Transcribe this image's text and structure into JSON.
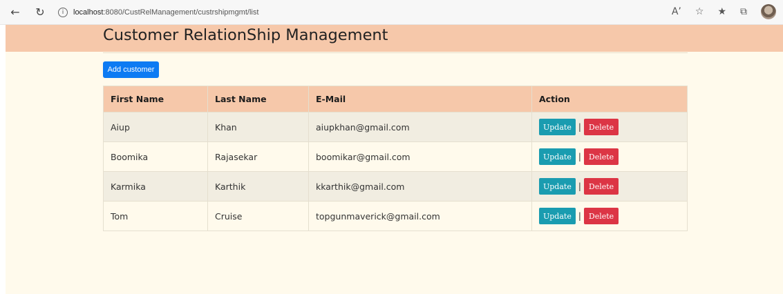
{
  "browser": {
    "back_icon": "arrow-left-icon",
    "reload_icon": "reload-icon",
    "info_icon": "info-icon",
    "url_host": "localhost",
    "url_rest": ":8080/CustRelManagement/custrshipmgmt/list",
    "right_icons": [
      "read-aloud-icon",
      "add-favorite-icon",
      "favorites-icon",
      "collections-icon",
      "profile-avatar"
    ]
  },
  "page": {
    "title": "Customer RelationShip Management",
    "add_button": "Add customer"
  },
  "table": {
    "headers": [
      "First Name",
      "Last Name",
      "E-Mail",
      "Action"
    ],
    "rows": [
      {
        "first": "Aiup",
        "last": "Khan",
        "email": "aiupkhan@gmail.com"
      },
      {
        "first": "Boomika",
        "last": "Rajasekar",
        "email": "boomikar@gmail.com"
      },
      {
        "first": "Karmika",
        "last": "Karthik",
        "email": "kkarthik@gmail.com"
      },
      {
        "first": "Tom",
        "last": "Cruise",
        "email": "topgunmaverick@gmail.com"
      }
    ],
    "update_label": "Update",
    "delete_label": "Delete",
    "separator": "|"
  },
  "colors": {
    "header_band": "#f6c8aa",
    "page_bg": "#fffaec",
    "add_button": "#0d7bf3",
    "update_button": "#1a9cb0",
    "delete_button": "#dc3545"
  }
}
